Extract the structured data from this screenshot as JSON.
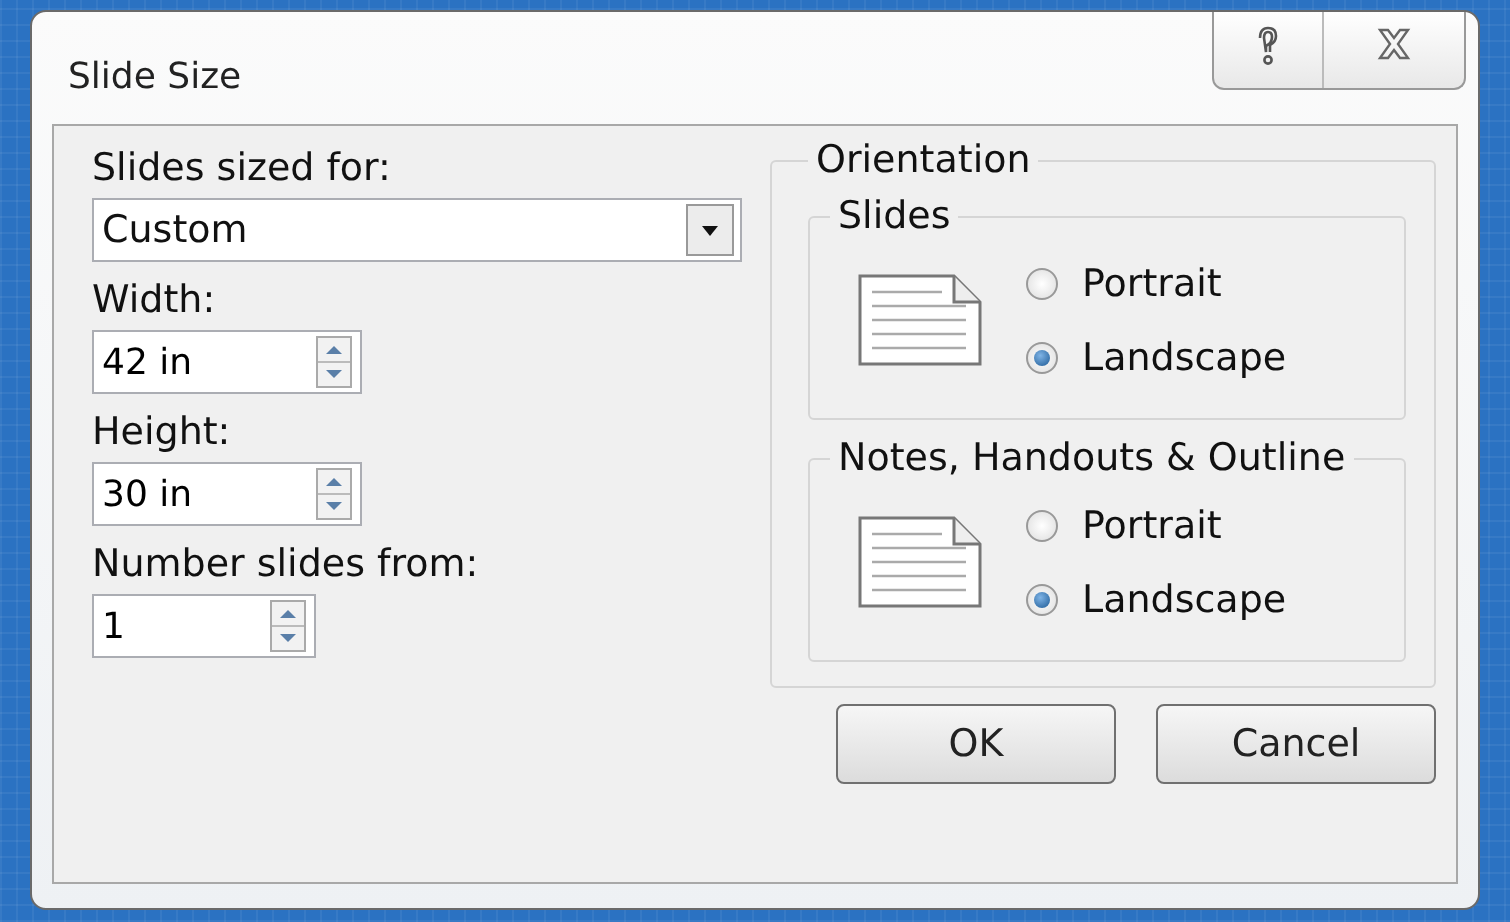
{
  "window": {
    "title": "Slide Size"
  },
  "slide_size": {
    "label": "Slides sized for:",
    "value": "Custom"
  },
  "fields": [
    {
      "label": "Width:",
      "value": "42 in"
    },
    {
      "label": "Height:",
      "value": "30 in"
    },
    {
      "label": "Number slides from:",
      "value": "1"
    }
  ],
  "orientation": {
    "title": "Orientation",
    "groups": [
      {
        "title": "Slides",
        "options": [
          {
            "label": "Portrait",
            "selected": false
          },
          {
            "label": "Landscape",
            "selected": true
          }
        ]
      },
      {
        "title": "Notes, Handouts & Outline",
        "options": [
          {
            "label": "Portrait",
            "selected": false
          },
          {
            "label": "Landscape",
            "selected": true
          }
        ]
      }
    ]
  },
  "buttons": [
    {
      "label": "OK"
    },
    {
      "label": "Cancel"
    }
  ]
}
